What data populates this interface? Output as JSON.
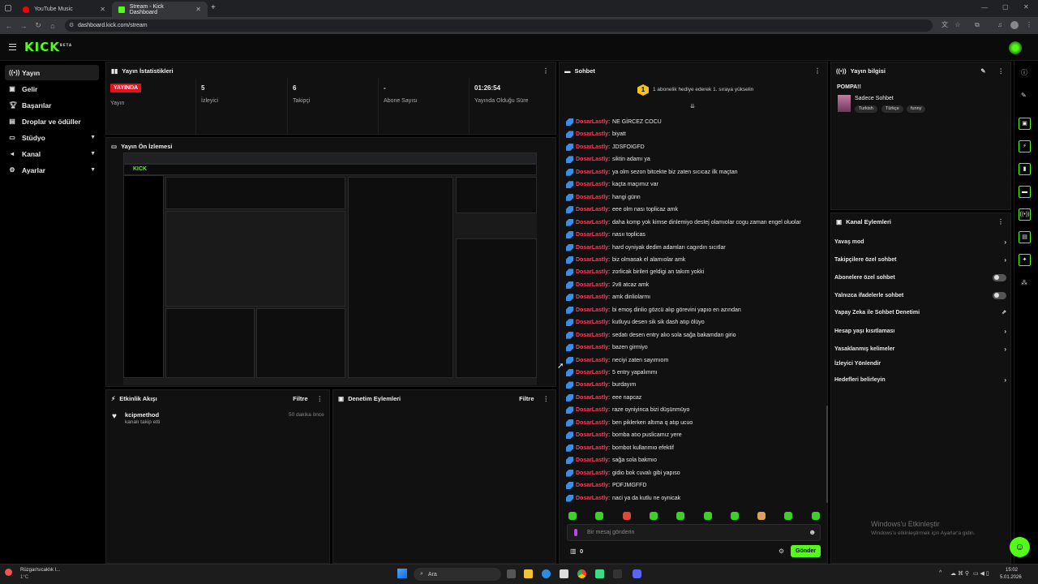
{
  "browser": {
    "tabs": [
      {
        "title": "YouTube Music",
        "color": "#ff0000",
        "active": false
      },
      {
        "title": "Stream - Kick Dashboard",
        "color": "#53fc18",
        "active": true
      }
    ],
    "url": "dashboard.kick.com/stream"
  },
  "header": {
    "logo": "KICK",
    "logo_sup": "BETA"
  },
  "sidebar": {
    "items": [
      {
        "label": "Yayın",
        "icon": "broadcast-icon",
        "active": true
      },
      {
        "label": "Gelir",
        "icon": "revenue-icon"
      },
      {
        "label": "Başarılar",
        "icon": "trophy-icon"
      },
      {
        "label": "Droplar ve ödüller",
        "icon": "gift-icon"
      },
      {
        "label": "Stüdyo",
        "icon": "studio-icon",
        "expandable": true
      },
      {
        "label": "Kanal",
        "icon": "channel-icon",
        "expandable": true
      },
      {
        "label": "Ayarlar",
        "icon": "gear-icon",
        "expandable": true
      }
    ]
  },
  "stats": {
    "title": "Yayın İstatistikleri",
    "live_badge": "YAYINDA",
    "items": [
      {
        "value": "",
        "label": "Yayın"
      },
      {
        "value": "5",
        "label": "İzleyici"
      },
      {
        "value": "6",
        "label": "Takipçi"
      },
      {
        "value": "-",
        "label": "Abone Sayısı"
      },
      {
        "value": "01:26:54",
        "label": "Yayında Olduğu Süre"
      }
    ]
  },
  "preview": {
    "title": "Yayın Ön İzlemesi"
  },
  "activity": {
    "title": "Etkinlik Akışı",
    "filter": "Filtre",
    "events": [
      {
        "user": "kcipmethod",
        "desc": "kanalı takip etti",
        "time": "50 dakika önce"
      }
    ]
  },
  "moderation": {
    "title": "Denetim Eylemleri",
    "filter": "Filtre"
  },
  "chat": {
    "title": "Sohbet",
    "banner": "1 abonelik hediye ederek 1. sıraya yükselin",
    "banner_rank": "1",
    "username": "DosarLastly",
    "messages": [
      "NE GİRCEZ COCU",
      "biyatt",
      "JDSFOIGFD",
      "siktin adamı ya",
      "ya olm sezon bitcekte biz zaten sıcıcaz ilk maçtan",
      "kaçta maçımız var",
      "hangi günn",
      "eee olm nası toplicaz amk",
      "daha komp yok kimse dinlemiyo destej olamıolar cogu zaman engel oluolar",
      "nasıı toplicas",
      "hard oyniyak dedim adamları cagırdın sıcıtlar",
      "biz olmasak el alamıolar amk",
      "zorlicak birileri geldigi an takım yokki",
      "2v8 atcaz amk",
      "amk dinliolarmı",
      "bi emoş dinlio gözcü alıp görevini yapıo en azından",
      "kutluyu desen sik sik dash atıp ölüyo",
      "sedatı desen entry alıo sola sağa bakamdan girio",
      "bazen girmiyo",
      "neciyi zaten sayımıom",
      "5 entry yapalımmı",
      "burdayım",
      "eee napcaz",
      "raze oyniyinca bizi düşünmüyo",
      "ben piklerken altıma q atıp ucuo",
      "bomba atıo puslicamız yere",
      "bombot kullanmıo efektif",
      "sağa sola bakmıo",
      "gidio bok cuvalı gibi yapıso",
      "PDFJMGFFD",
      "naci ya da kutlu ne oynicak"
    ],
    "input_placeholder": "Bir mesaj gönderin",
    "points": "0",
    "send": "Gönder"
  },
  "stream_info": {
    "title": "Yayın bilgisi",
    "stream_title": "POMPA!!",
    "category": "Sadece Sohbet",
    "tags": [
      "Turkish",
      "Türkçe",
      "funny"
    ]
  },
  "channel_actions": {
    "title": "Kanal Eylemleri",
    "items": [
      {
        "label": "Yavaş mod",
        "control": "chevron"
      },
      {
        "label": "Takipçilere özel sohbet",
        "control": "chevron"
      },
      {
        "label": "Abonelere özel sohbet",
        "control": "toggle"
      },
      {
        "label": "Yalnızca ifadelerle sohbet",
        "control": "toggle"
      },
      {
        "label": "Yapay Zeka ile Sohbet Denetimi",
        "control": "external"
      },
      {
        "label": "Hesap yaşı kısıtlaması",
        "control": "chevron"
      },
      {
        "label": "Yasaklanmış kelimeler",
        "control": "chevron"
      },
      {
        "label": "İzleyici Yönlendir",
        "control": "none"
      },
      {
        "label": "Hedefleri belirleyin",
        "control": "chevron"
      }
    ]
  },
  "watermark": {
    "line1": "Windows'u Etkinleştir",
    "line2": "Windows'u etkinleştirmek için Ayarlar'a gidin."
  },
  "taskbar": {
    "weather_title": "Rüzgar/sıcaklık l...",
    "weather_temp": "1°C",
    "search": "Ara",
    "time": "15:02",
    "date": "5.01.2026"
  },
  "colors": {
    "accent": "#53fc18",
    "live": "#e8101f",
    "username": "#ff3b5c"
  }
}
